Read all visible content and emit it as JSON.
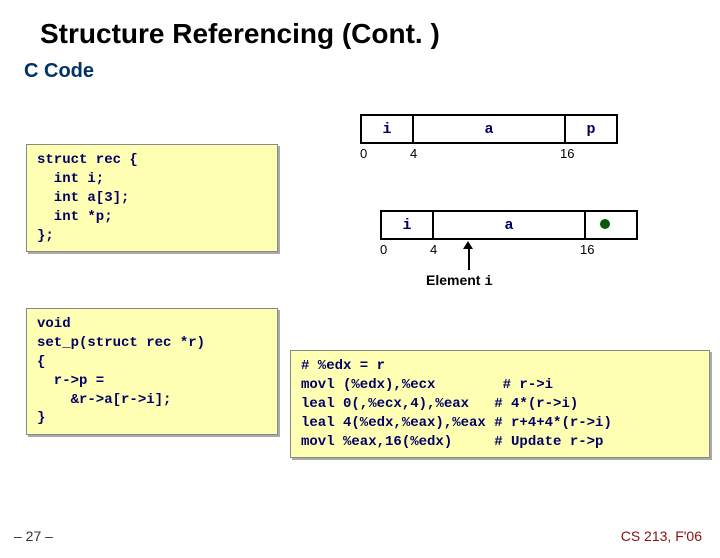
{
  "title": "Structure Referencing (Cont. )",
  "subtitle": "C Code",
  "code1": "struct rec {\n  int i;\n  int a[3];\n  int *p;\n};",
  "code2": "void\nset_p(struct rec *r)\n{\n  r->p =\n    &r->a[r->i];\n}",
  "code3": "# %edx = r\nmovl (%edx),%ecx        # r->i\nleal 0(,%ecx,4),%eax   # 4*(r->i)\nleal 4(%edx,%eax),%eax # r+4+4*(r->i)\nmovl %eax,16(%edx)     # Update r->p",
  "diag": {
    "fields": {
      "i": "i",
      "a": "a",
      "p": "p"
    },
    "offsets": {
      "o0": "0",
      "o4": "4",
      "o16": "16"
    }
  },
  "element_label": "Element",
  "element_var": "i",
  "footer_left": "– 27 –",
  "footer_right": "CS 213, F'06"
}
